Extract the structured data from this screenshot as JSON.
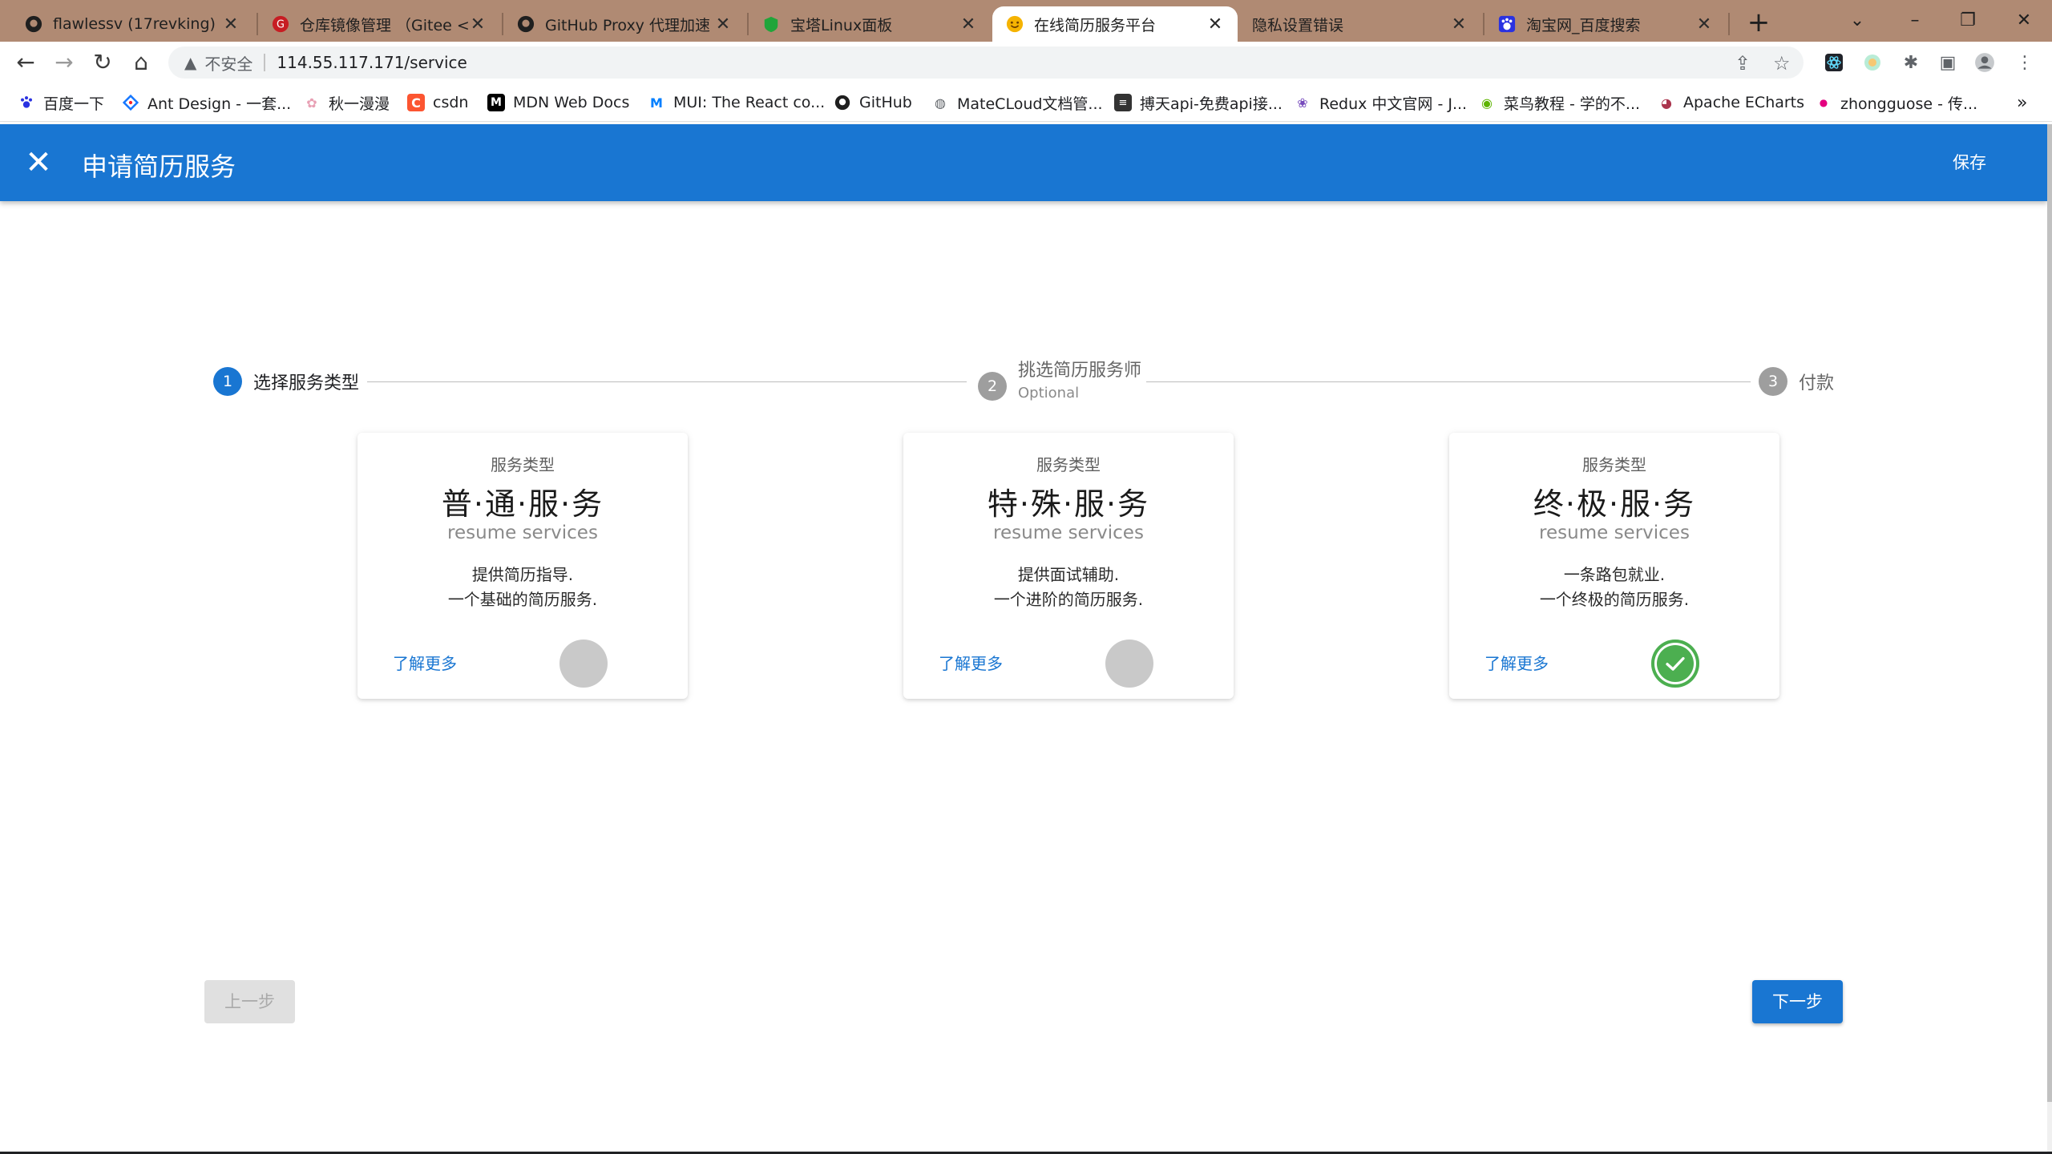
{
  "browser": {
    "tabs": [
      {
        "title": "flawlessv (17revking)",
        "icon": "github-icon",
        "active": false
      },
      {
        "title": "仓库镜像管理 （Gitee <",
        "icon": "gitee-icon",
        "active": false
      },
      {
        "title": "GitHub Proxy 代理加速",
        "icon": "github-icon",
        "active": false
      },
      {
        "title": "宝塔Linux面板",
        "icon": "baota-icon",
        "active": false
      },
      {
        "title": "在线简历服务平台",
        "icon": "smile-icon",
        "active": true
      },
      {
        "title": "隐私设置错误",
        "icon": "none",
        "active": false
      },
      {
        "title": "淘宝网_百度搜索",
        "icon": "baidu-icon",
        "active": false
      }
    ],
    "address": {
      "security_label": "不安全",
      "url": "114.55.117.171/service"
    },
    "bookmarks": [
      {
        "label": "百度一下",
        "icon": "baidu-icon"
      },
      {
        "label": "Ant Design - 一套...",
        "icon": "antd-icon"
      },
      {
        "label": "秋一漫漫",
        "icon": "flower-icon"
      },
      {
        "label": "csdn",
        "icon": "csdn-icon"
      },
      {
        "label": "MDN Web Docs",
        "icon": "mdn-icon"
      },
      {
        "label": "MUI: The React co...",
        "icon": "mui-icon"
      },
      {
        "label": "GitHub",
        "icon": "github-icon"
      },
      {
        "label": "MateCLoud文档管...",
        "icon": "globe-icon"
      },
      {
        "label": "搏天api-免费api接...",
        "icon": "api-icon"
      },
      {
        "label": "Redux 中文官网 - J...",
        "icon": "redux-icon"
      },
      {
        "label": "菜鸟教程 - 学的不...",
        "icon": "runoob-icon"
      },
      {
        "label": "Apache ECharts",
        "icon": "echarts-icon"
      },
      {
        "label": "zhongguose - 传...",
        "icon": "dot-icon"
      }
    ]
  },
  "appbar": {
    "title": "申请简历服务",
    "save_label": "保存"
  },
  "stepper": {
    "steps": [
      {
        "number": "1",
        "label": "选择服务类型",
        "optional": "",
        "state": "active"
      },
      {
        "number": "2",
        "label": "挑选简历服务师",
        "optional": "Optional",
        "state": "inactive"
      },
      {
        "number": "3",
        "label": "付款",
        "optional": "",
        "state": "inactive"
      }
    ]
  },
  "cards": [
    {
      "overline": "服务类型",
      "name": "普·通·服·务",
      "subtitle": "resume services",
      "desc_line1": "提供简历指导.",
      "desc_line2": "一个基础的简历服务.",
      "learn_more": "了解更多",
      "selected": false
    },
    {
      "overline": "服务类型",
      "name": "特·殊·服·务",
      "subtitle": "resume services",
      "desc_line1": "提供面试辅助.",
      "desc_line2": "一个进阶的简历服务.",
      "learn_more": "了解更多",
      "selected": false
    },
    {
      "overline": "服务类型",
      "name": "终·极·服·务",
      "subtitle": "resume services",
      "desc_line1": "一条路包就业.",
      "desc_line2": "一个终极的简历服务.",
      "learn_more": "了解更多",
      "selected": true
    }
  ],
  "footer": {
    "prev_label": "上一步",
    "next_label": "下一步"
  },
  "colors": {
    "primary": "#1976d2",
    "selected_green": "#4caf50",
    "tabstrip": "#b08a73"
  }
}
